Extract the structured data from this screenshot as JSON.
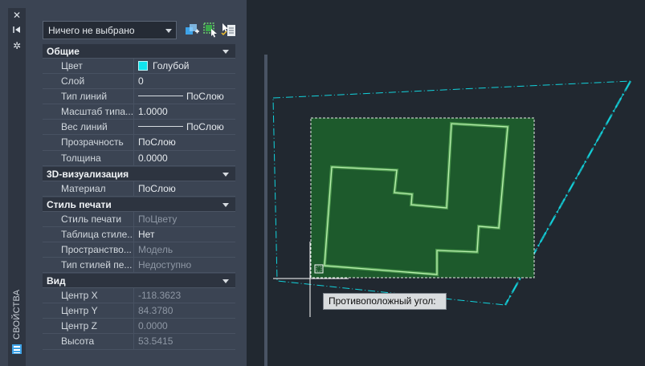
{
  "palette": {
    "side_title": "СВОЙСТВА",
    "strip_icons": [
      "close-icon",
      "pin-icon",
      "settings-icon"
    ],
    "selector": {
      "value": "Ничего не выбрано"
    },
    "toolbar_icons": [
      "toggle-pickadd-icon",
      "select-objects-icon",
      "quick-select-icon"
    ],
    "sections": [
      {
        "title": "Общие",
        "rows": [
          {
            "key": "Цвет",
            "value": "Голубой",
            "swatch": "#11e4ee"
          },
          {
            "key": "Слой",
            "value": "0"
          },
          {
            "key": "Тип линий",
            "value": "ПоСлою",
            "line": true
          },
          {
            "key": "Масштаб типа...",
            "value": "1.0000"
          },
          {
            "key": "Вес линий",
            "value": "ПоСлою",
            "line": true
          },
          {
            "key": "Прозрачность",
            "value": "ПоСлою"
          },
          {
            "key": "Толщина",
            "value": "0.0000"
          }
        ]
      },
      {
        "title": "3D-визуализация",
        "rows": [
          {
            "key": "Материал",
            "value": "ПоСлою"
          }
        ]
      },
      {
        "title": "Стиль печати",
        "rows": [
          {
            "key": "Стиль печати",
            "value": "ПоЦвету",
            "readonly": true
          },
          {
            "key": "Таблица  стиле...",
            "value": "Нет"
          },
          {
            "key": "Пространство...",
            "value": "Модель",
            "readonly": true
          },
          {
            "key": "Тип стилей пе...",
            "value": "Недоступно",
            "readonly": true
          }
        ]
      },
      {
        "title": "Вид",
        "rows": [
          {
            "key": "Центр X",
            "value": "-118.3623",
            "readonly": true
          },
          {
            "key": "Центр Y",
            "value": "84.3780",
            "readonly": true
          },
          {
            "key": "Центр Z",
            "value": "0.0000",
            "readonly": true
          },
          {
            "key": "Высота",
            "value": "53.5415",
            "readonly": true
          }
        ]
      }
    ]
  },
  "drawing": {
    "tooltip": "Противоположный угол:",
    "colors": {
      "background": "#212830",
      "selection_fill": "#1d5a2c",
      "polyline": "#7fdb72",
      "boundary": "#11e4ee",
      "crosshair": "#ffffff"
    }
  }
}
